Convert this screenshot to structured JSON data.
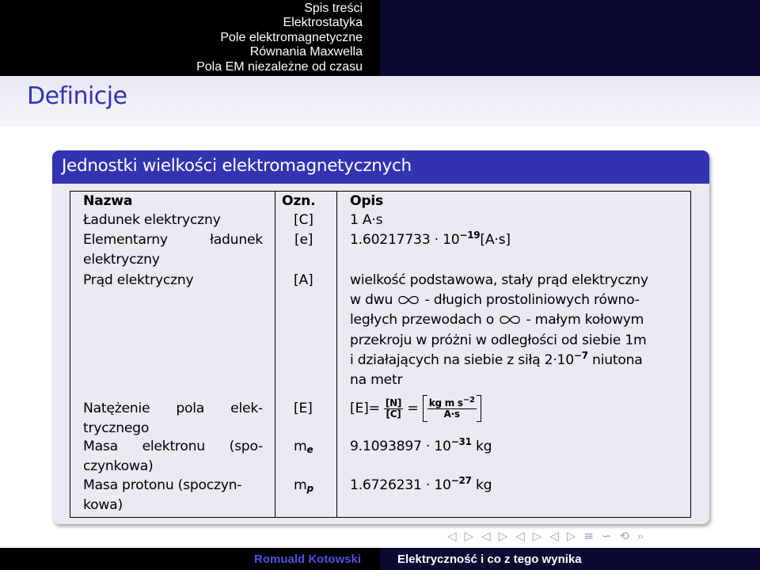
{
  "nav": {
    "items": [
      "Spis treści",
      "Elektrostatyka",
      "Pole elektromagnetyczne",
      "Równania Maxwella",
      "Pola EM niezależne od czasu"
    ],
    "active_index": 0
  },
  "frame": {
    "title": "Definicje"
  },
  "block": {
    "title": "Jednostki wielkości elektromagnetycznych"
  },
  "table": {
    "headers": [
      "Nazwa",
      "Ozn.",
      "Opis"
    ],
    "rows": {
      "r0": {
        "name": "Ładunek elektryczny",
        "sym": "[C]",
        "desc": "1 A·s"
      },
      "r1": {
        "name_a": "Elementarny",
        "name_b": "ładunek",
        "name_c": "elektryczny",
        "sym": "[e]",
        "desc_mant": "1.60217733 · 10",
        "desc_exp": "−19",
        "desc_unit": "[A·s]"
      },
      "r2": {
        "name": "Prąd elektryczny",
        "sym": "[A]",
        "l1": "wielkość podstawowa, stały prąd elektryczny",
        "l2a": "w dwu",
        "l2b": "- długich prostoliniowych równo-",
        "l3a": "ległych przewodach o",
        "l3b": "- małym kołowym",
        "l4": "przekroju w próżni w odległości od siebie 1m",
        "l5a": "i działających na siebie z siłą 2·10",
        "l5exp": "−7",
        "l5b": "niutona",
        "l6": "na metr"
      },
      "r3": {
        "name_a": "Natężenie",
        "name_b": "pola",
        "name_c": "elek-",
        "name_d": "trycznego",
        "sym": "[E]",
        "desc_lhs": "[E]=",
        "frac1_num": "[N]",
        "frac1_den": "[C]",
        "eq": "=",
        "frac2_num": "kg m s",
        "frac2_exp": "−2",
        "frac2_den": "A·s"
      },
      "r4": {
        "name_a": "Masa",
        "name_b": "elektronu",
        "name_c": "(spo-",
        "name_d": "czynkowa)",
        "sym_base": "m",
        "sym_sub": "e",
        "desc_mant": "9.1093897 · 10",
        "desc_exp": "−31",
        "desc_unit": "kg"
      },
      "r5": {
        "name_a": "Masa protonu (spoczyn-",
        "name_b": "kowa)",
        "sym_base": "m",
        "sym_sub": "p",
        "desc_mant": "1.6726231 · 10",
        "desc_exp": "−27",
        "desc_unit": "kg"
      }
    }
  },
  "footer": {
    "author": "Romuald Kotowski",
    "title": "Elektryczność i co z tego wynika"
  },
  "nav_symbols": [
    "◁",
    "▷",
    "◁",
    "▷",
    "◁",
    "▷",
    "◁",
    "▷",
    "≡",
    "∽",
    "⟲",
    "⌕"
  ],
  "colors": {
    "structure": "#3333b2",
    "nav_bg": "#000000",
    "nav_bg2": "#0a0a33",
    "block_bg": "#eaeaf3"
  }
}
